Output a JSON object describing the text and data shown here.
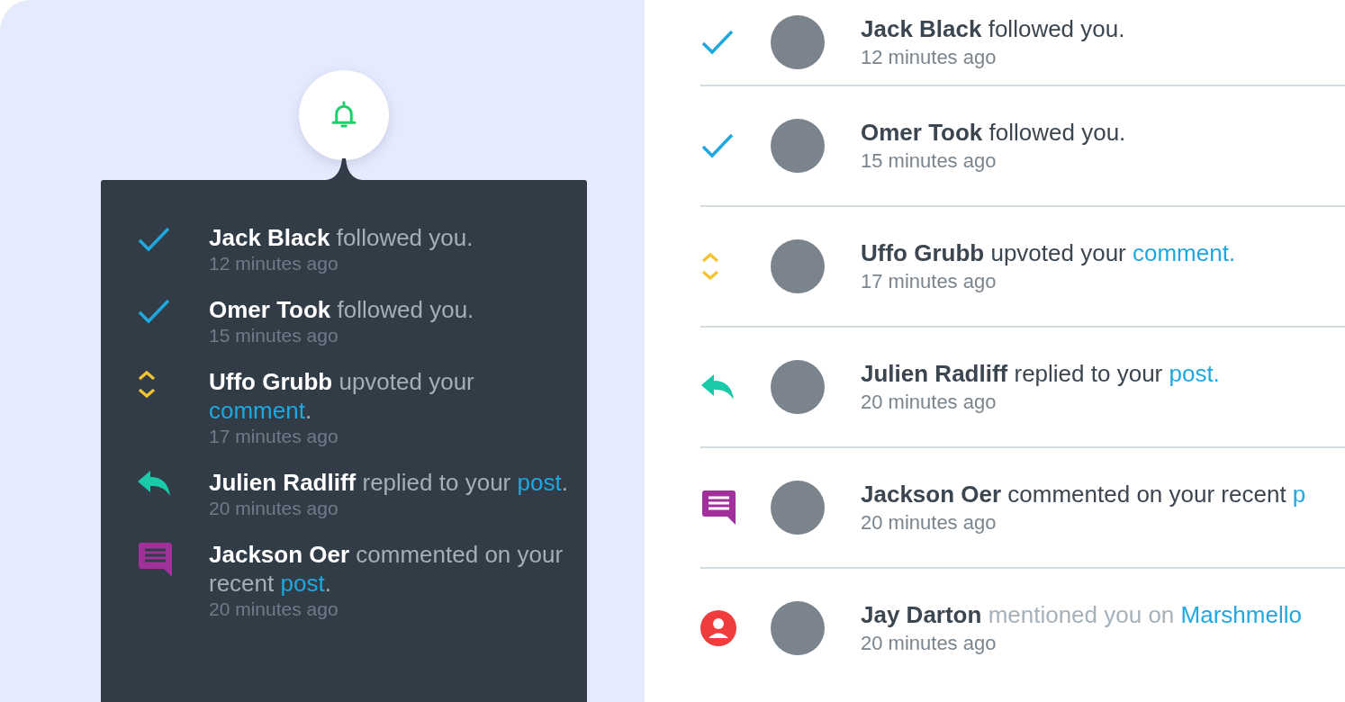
{
  "popup": {
    "notifications": [
      {
        "kind": "follow",
        "actor": "Jack Black",
        "action": "followed you.",
        "time": "12 minutes ago"
      },
      {
        "kind": "follow",
        "actor": "Omer Took",
        "action": "followed you.",
        "time": "15 minutes ago"
      },
      {
        "kind": "upvote",
        "actor": "Uffo Grubb",
        "action": "upvoted your",
        "link": "comment",
        "suffix": ".",
        "time": "17 minutes ago"
      },
      {
        "kind": "reply",
        "actor": "Julien Radliff",
        "action": "replied to your",
        "link": "post",
        "suffix": ".",
        "time": "20 minutes ago"
      },
      {
        "kind": "comment",
        "actor": "Jackson Oer",
        "action": "commented on your recent",
        "link": "post",
        "suffix": ".",
        "time": "20 minutes ago"
      }
    ]
  },
  "list": {
    "notifications": [
      {
        "kind": "follow",
        "actor": "Jack Black",
        "action": "followed you.",
        "dim": false,
        "time": "12 minutes ago"
      },
      {
        "kind": "follow",
        "actor": "Omer Took",
        "action": "followed you.",
        "dim": false,
        "time": "15 minutes ago"
      },
      {
        "kind": "upvote",
        "actor": "Uffo Grubb",
        "action": "upvoted your",
        "link": "comment.",
        "dim": false,
        "time": "17 minutes ago"
      },
      {
        "kind": "reply",
        "actor": "Julien Radliff",
        "action": "replied to your",
        "link": "post.",
        "dim": false,
        "time": "20 minutes ago"
      },
      {
        "kind": "comment",
        "actor": "Jackson Oer",
        "action": "commented on your recent",
        "link": "p",
        "dim": false,
        "time": "20 minutes ago"
      },
      {
        "kind": "mention",
        "actor": "Jay Darton",
        "action": "mentioned you on",
        "link": "Marshmello",
        "dim": true,
        "time": "20 minutes ago"
      }
    ]
  }
}
